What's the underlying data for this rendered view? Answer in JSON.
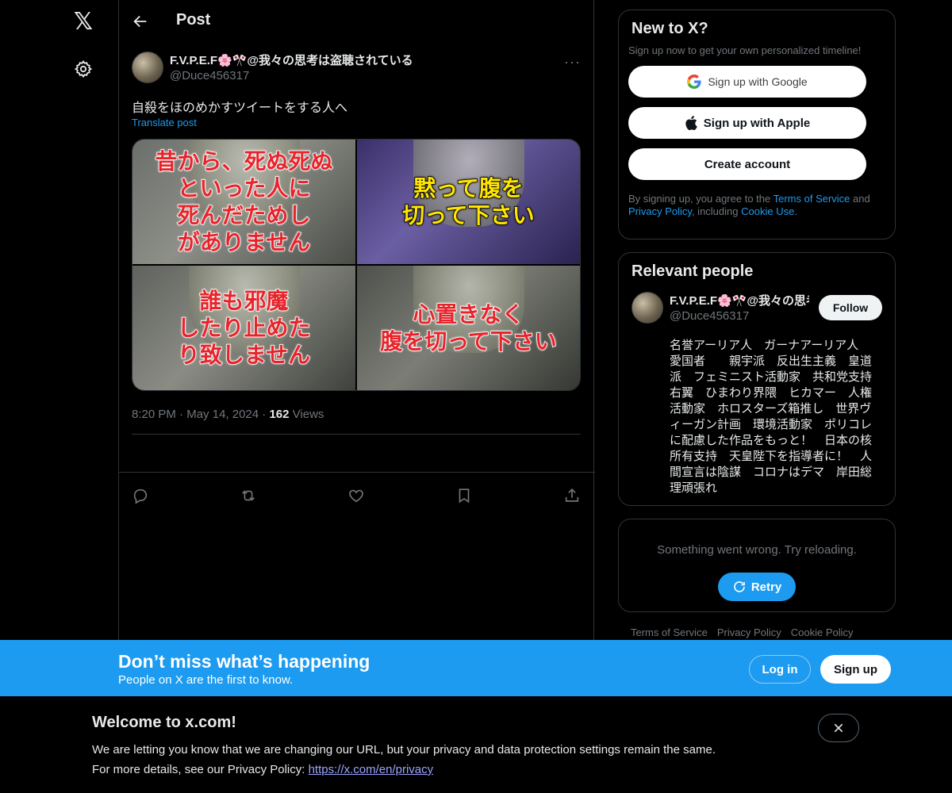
{
  "header": {
    "title": "Post"
  },
  "post": {
    "author_name": "F.V.P.E.F🌸🎌@我々の思考は盗聴されている",
    "author_handle": "@Duce456317",
    "more": "···",
    "text": "自殺をほのめかすツイートをする人へ",
    "translate": "Translate post",
    "images": [
      {
        "caption": "昔から、死ぬ死ぬ\nといった人に\n死んだためし\nがありません"
      },
      {
        "caption": "黙って腹を\n切って下さい"
      },
      {
        "caption": "誰も邪魔\nしたり止めた\nり致しません"
      },
      {
        "caption": "心置きなく\n腹を切って下さい"
      }
    ],
    "time": "8:20 PM",
    "date": "May 14, 2024",
    "views_count": "162",
    "views_label": "Views",
    "sep": "·"
  },
  "signup_card": {
    "title": "New to X?",
    "subtitle": "Sign up now to get your own personalized timeline!",
    "google": "Sign up with Google",
    "apple": "Sign up with Apple",
    "create": "Create account",
    "legal_pre": "By signing up, you agree to the ",
    "terms": "Terms of Service",
    "legal_and": " and ",
    "privacy": "Privacy Policy",
    "legal_mid": ", including ",
    "cookie": "Cookie Use",
    "legal_end": "."
  },
  "relevant": {
    "title": "Relevant people",
    "name": "F.V.P.E.F🌸🎌@我々の思考は盗聴されている",
    "handle": "@Duce456317",
    "follow": "Follow",
    "bio": "名誉アーリア人　ガーナアーリア人　愛国者　　親宇派　反出生主義　皇道派　フェミニスト活動家　共和党支持　右翼　ひまわり界隈　ヒカマー　人権活動家　ホロスターズ箱推し　世界ヴィーガン計画　環境活動家　ポリコレに配慮した作品をもっと！　日本の核所有支持　天皇陛下を指導者に！　人間宣言は陰謀　コロナはデマ　岸田総理頑張れ"
  },
  "error_card": {
    "text": "Something went wrong. Try reloading.",
    "retry": "Retry"
  },
  "footer": {
    "terms": "Terms of Service",
    "privacy": "Privacy Policy",
    "cookie": "Cookie Policy"
  },
  "signup_bar": {
    "title": "Don’t miss what’s happening",
    "subtitle": "People on X are the first to know.",
    "login": "Log in",
    "signup": "Sign up"
  },
  "welcome": {
    "title": "Welcome to x.com!",
    "line1": "We are letting you know that we are changing our URL, but your privacy and data protection settings remain the same.",
    "line2_pre": "For more details, see our Privacy Policy: ",
    "link": "https://x.com/en/privacy"
  },
  "icons": {
    "logo": "x-logo-icon",
    "settings": "gear-icon",
    "back": "back-arrow-icon",
    "reply": "reply-icon",
    "repost": "repost-icon",
    "like": "heart-icon",
    "bookmark": "bookmark-icon",
    "share": "share-icon",
    "retry": "refresh-icon",
    "close": "close-icon"
  },
  "colors": {
    "accent": "#1d9bf0",
    "background": "#000000",
    "text": "#e7e9ea",
    "muted": "#71767b",
    "border": "#2f3336"
  }
}
